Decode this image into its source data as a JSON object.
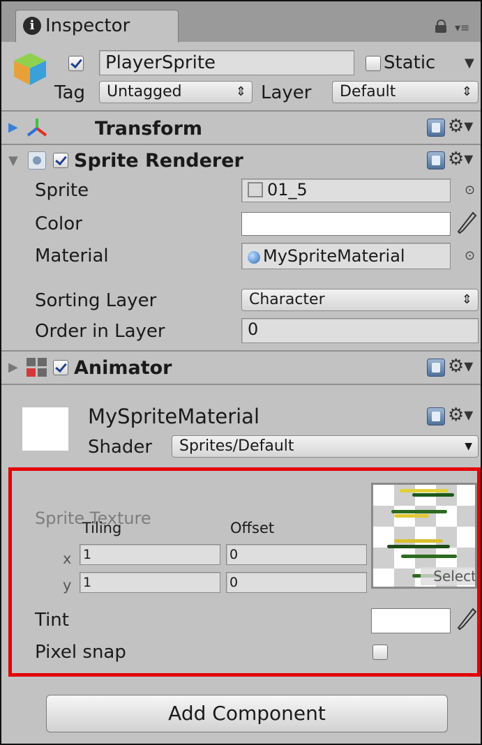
{
  "tab": {
    "icon": "info-icon",
    "title": "Inspector"
  },
  "tab_controls": {
    "lock": "lock-icon",
    "menu": "menu-icon"
  },
  "game_object": {
    "icon": "gameobject-cube-icon",
    "active": true,
    "name": "PlayerSprite",
    "static_label": "Static",
    "static_checked": false,
    "tag_label": "Tag",
    "tag_value": "Untagged",
    "layer_label": "Layer",
    "layer_value": "Default"
  },
  "transform": {
    "title": "Transform",
    "icon": "transform-axes-icon",
    "expanded": false
  },
  "sprite_renderer": {
    "title": "Sprite Renderer",
    "enabled": true,
    "expanded": true,
    "sprite_label": "Sprite",
    "sprite_value": "01_5",
    "color_label": "Color",
    "color_value": "#ffffff",
    "material_label": "Material",
    "material_value": "MySpriteMaterial",
    "sorting_layer_label": "Sorting Layer",
    "sorting_layer_value": "Character",
    "order_label": "Order in Layer",
    "order_value": "0"
  },
  "animator": {
    "title": "Animator",
    "enabled": true,
    "expanded": false
  },
  "material": {
    "name": "MySpriteMaterial",
    "shader_label": "Shader",
    "shader_value": "Sprites/Default",
    "sprite_texture_label": "Sprite Texture",
    "tiling_label": "Tiling",
    "offset_label": "Offset",
    "x_label": "x",
    "y_label": "y",
    "tiling_x": "1",
    "tiling_y": "1",
    "offset_x": "0",
    "offset_y": "0",
    "select_label": "Select",
    "tint_label": "Tint",
    "tint_value": "#ffffff",
    "pixel_snap_label": "Pixel snap",
    "pixel_snap": false
  },
  "add_component_label": "Add Component",
  "colors": {
    "highlight_border": "#e10000",
    "panel_bg": "#c2c2c2",
    "header_bg": "#9a9a9a"
  }
}
